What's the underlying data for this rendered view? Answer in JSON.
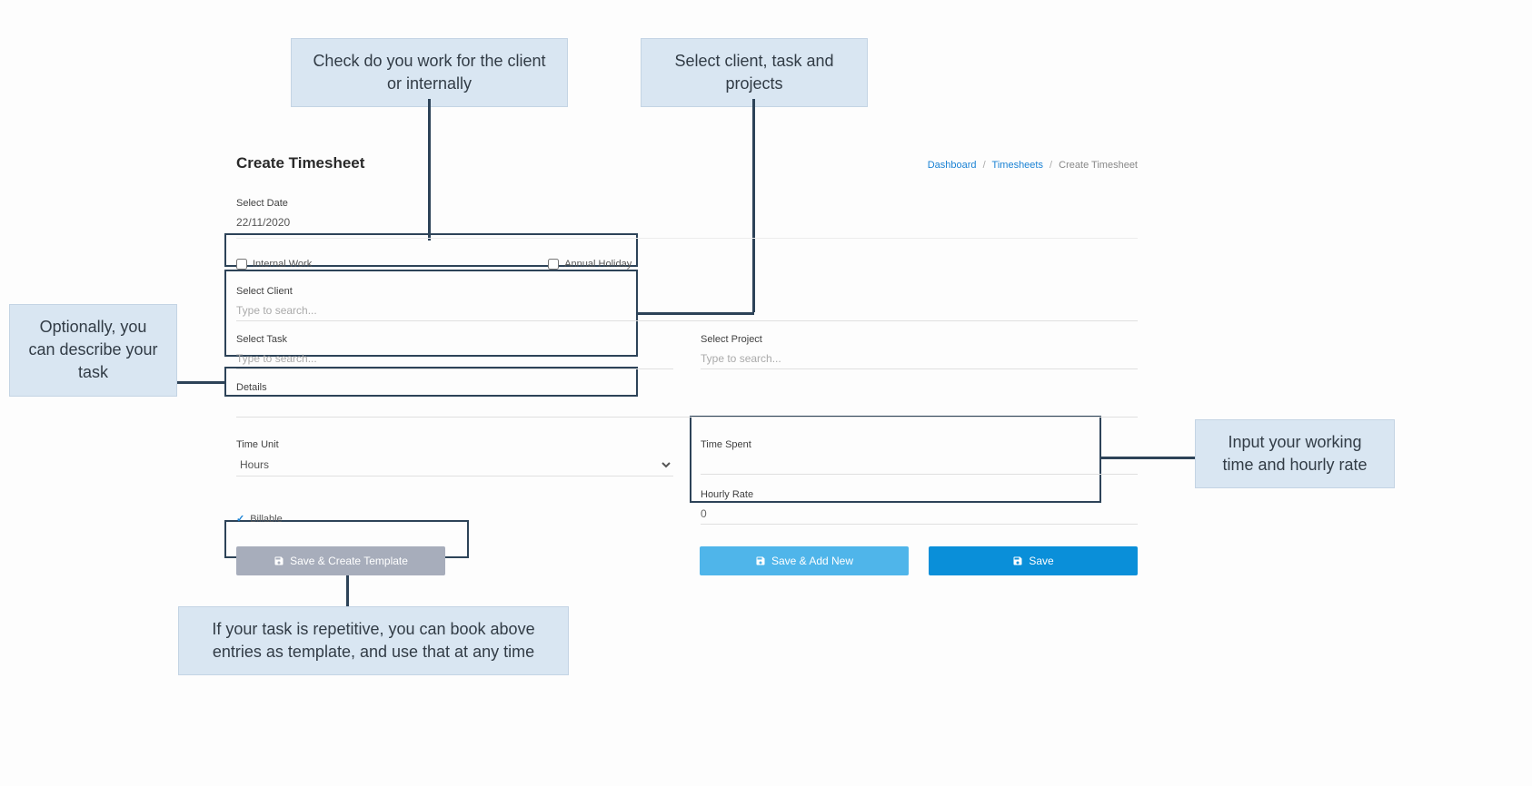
{
  "callouts": {
    "workType": "Check do you work for the client or internally",
    "clientTask": "Select client, task and projects",
    "describe": "Optionally, you can describe your task",
    "timeRate": "Input your working time and hourly rate",
    "template": "If your task is repetitive, you can book above entries as template, and use that at any time"
  },
  "page": {
    "title": "Create Timesheet"
  },
  "breadcrumb": {
    "dashboard": "Dashboard",
    "timesheets": "Timesheets",
    "current": "Create Timesheet"
  },
  "form": {
    "selectDateLabel": "Select Date",
    "selectDateValue": "22/11/2020",
    "internalWorkLabel": "Internal Work",
    "annualHolidayLabel": "Annual Holiday",
    "selectClientLabel": "Select Client",
    "selectClientPlaceholder": "Type to search...",
    "selectTaskLabel": "Select Task",
    "selectTaskPlaceholder": "Type to search...",
    "selectProjectLabel": "Select Project",
    "selectProjectPlaceholder": "Type to search...",
    "detailsLabel": "Details",
    "timeUnitLabel": "Time Unit",
    "timeUnitValue": "Hours",
    "timeSpentLabel": "Time Spent",
    "hourlyRateLabel": "Hourly Rate",
    "hourlyRateValue": "0",
    "billableLabel": "Billable"
  },
  "buttons": {
    "saveTemplate": "Save & Create Template",
    "saveAddNew": "Save & Add New",
    "save": "Save"
  }
}
